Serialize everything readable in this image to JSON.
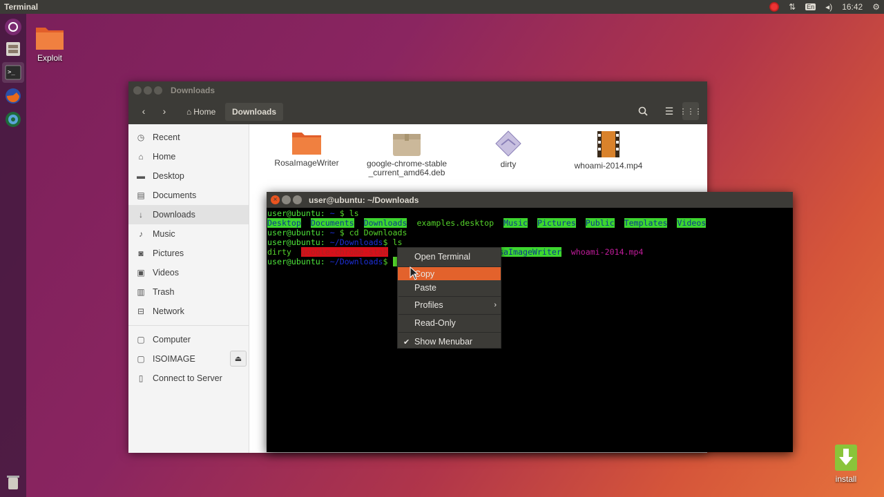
{
  "topbar": {
    "app_title": "Terminal",
    "lang": "En",
    "clock": "16:42"
  },
  "desktop": {
    "exploit_label": "Exploit",
    "install_label": "install"
  },
  "files": {
    "title": "Downloads",
    "crumbs": {
      "home": "Home",
      "current": "Downloads"
    },
    "sidebar": [
      {
        "label": "Recent"
      },
      {
        "label": "Home"
      },
      {
        "label": "Desktop"
      },
      {
        "label": "Documents"
      },
      {
        "label": "Downloads"
      },
      {
        "label": "Music"
      },
      {
        "label": "Pictures"
      },
      {
        "label": "Videos"
      },
      {
        "label": "Trash"
      },
      {
        "label": "Network"
      }
    ],
    "devices": [
      {
        "label": "Computer"
      },
      {
        "label": "ISOIMAGE"
      },
      {
        "label": "Connect to Server"
      }
    ],
    "items": [
      {
        "label": "RosaImageWriter"
      },
      {
        "label": "google-chrome-stable_current_amd64.deb"
      },
      {
        "label": "dirty"
      },
      {
        "label": "whoami-2014.mp4"
      }
    ]
  },
  "terminal": {
    "title": "user@ubuntu: ~/Downloads",
    "prompt_home": "user@ubuntu:",
    "tilde": " ~",
    "downloads_path": " ~/Downloads",
    "dollar_ls": "$ ls",
    "dollar_cd": "$ cd Downloads",
    "dollar": "$",
    "ls1": [
      "Desktop",
      "Documents",
      "Downloads",
      "examples.desktop",
      "Music",
      "Pictures",
      "Public",
      "Templates",
      "Videos"
    ],
    "ls2": {
      "dirty": "dirty",
      "chrome": "google-chrome-stab",
      "rosa": "RosaImageWriter",
      "whoami": "whoami-2014.mp4"
    }
  },
  "context_menu": {
    "open_terminal": "Open Terminal",
    "copy": "Copy",
    "paste": "Paste",
    "profiles": "Profiles",
    "read_only": "Read-Only",
    "show_menubar": "Show Menubar"
  },
  "colors": {
    "accent": "#e3622c",
    "terminal_green": "#55d42b",
    "panel": "#3c3b37"
  }
}
